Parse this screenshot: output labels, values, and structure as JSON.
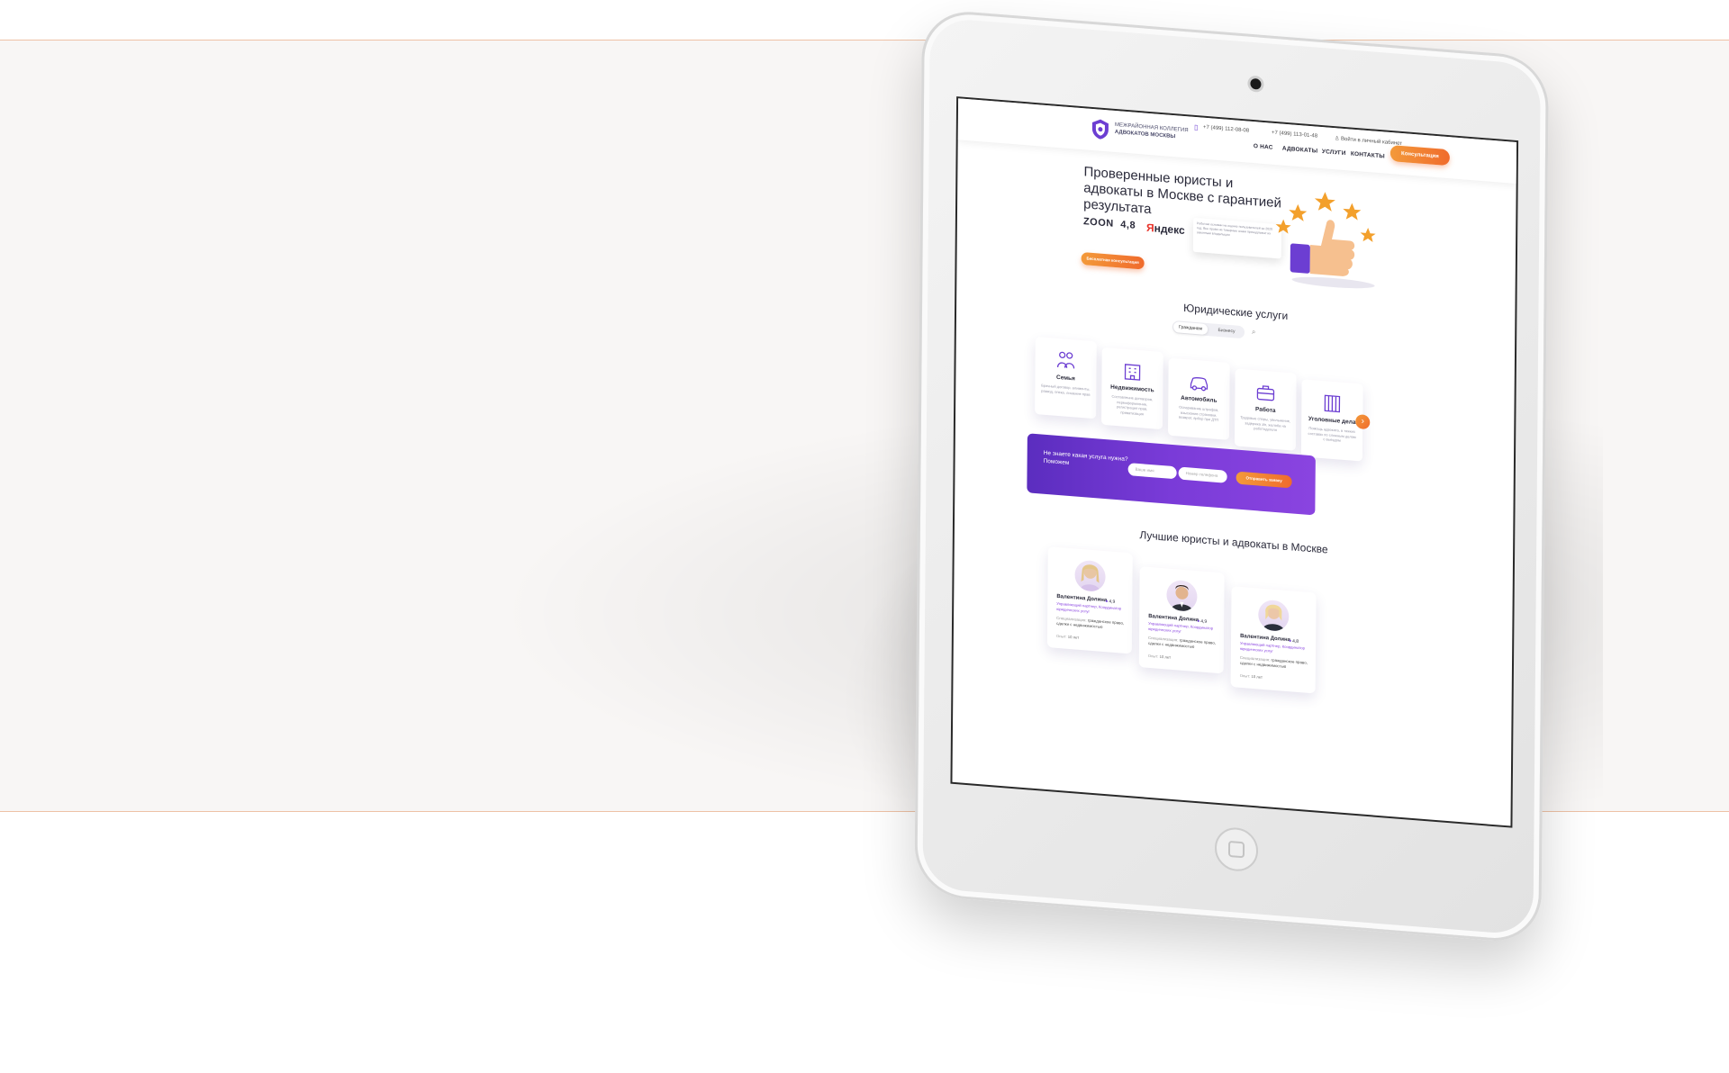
{
  "site": {
    "logo_lines": [
      "МЕЖРАЙОННАЯ КОЛЛЕГИЯ",
      "АДВОКАТОВ МОСКВЫ"
    ],
    "phones": [
      "+7 (499) 112-08-08",
      "+7 (499) 113-01-48"
    ],
    "login": "Войти в личный кабинет",
    "nav": [
      "О НАС",
      "АДВОКАТЫ",
      "УСЛУГИ",
      "КОНТАКТЫ"
    ],
    "consult_button": "Консультация"
  },
  "hero": {
    "title": "Проверенные юристы и адвокаты в Москве с гарантией результата",
    "zoon_label": "ZOON",
    "zoon_rating": "4,8",
    "yandex_first": "Я",
    "yandex_rest": "ндекс",
    "note": "Работаю основан на оценке пользователей за 2020 год. Все права на товарные знаки принадлежат их законным владельцам",
    "cta_button": "Бесплатная консультация"
  },
  "services": {
    "title": "Юридические услуги",
    "tabs": [
      "Гражданам",
      "Бизнесу"
    ],
    "cards": [
      {
        "title": "Семья",
        "desc": "Брачный договор, алименты, развод, опека, лишение прав",
        "icon": "family-icon"
      },
      {
        "title": "Недвижимость",
        "desc": "Составление договоров, переоформление, регистрация прав, приватизация",
        "icon": "building-icon"
      },
      {
        "title": "Автомобиль",
        "desc": "Оспаривание штрафов, взыскание страховки, возврат, ярбор при ДТП",
        "icon": "car-icon"
      },
      {
        "title": "Работа",
        "desc": "Трудовые споры, увольнение, задержка з/п, жалоба на работодателя",
        "icon": "briefcase-icon"
      },
      {
        "title": "Уголовные дела",
        "desc": "Помощь адвоката, в тяжких составах по сложным делам с выездом",
        "icon": "prison-icon"
      }
    ]
  },
  "cta": {
    "text": "Не знаете какая услуга нужна? Поможем",
    "name_placeholder": "Ваше имя",
    "phone_placeholder": "Номер телефона",
    "send_button": "Отправить заявку"
  },
  "lawyers": {
    "title": "Лучшие юристы и адвокаты в Москве",
    "items": [
      {
        "name": "Валентина Долина",
        "rating": "4,9",
        "role": "Управляющий партнер, Координатор юридических услуг",
        "spec_label": "Специализация:",
        "spec": "гражданское право, сделки с недвижимостью",
        "exp_label": "Опыт:",
        "exp": "10 лет"
      },
      {
        "name": "Валентина Долина",
        "rating": "4,9",
        "role": "Управляющий партнер, Координатор юридических услуг",
        "spec_label": "Специализация:",
        "spec": "гражданское право, сделки с недвижимостью",
        "exp_label": "Опыт:",
        "exp": "10 лет"
      },
      {
        "name": "Валентина Долина",
        "rating": "4,8",
        "role": "Управляющий партнер, Координатор юридических услуг",
        "spec_label": "Специализация:",
        "spec": "гражданское право, сделки с недвижимостью",
        "exp_label": "Опыт:",
        "exp": "10 лет"
      }
    ]
  },
  "colors": {
    "accent_orange": "#f06b2c",
    "accent_purple": "#6c3ed2",
    "band_border": "#eec2a6",
    "band_bg": "#f8f6f5"
  }
}
